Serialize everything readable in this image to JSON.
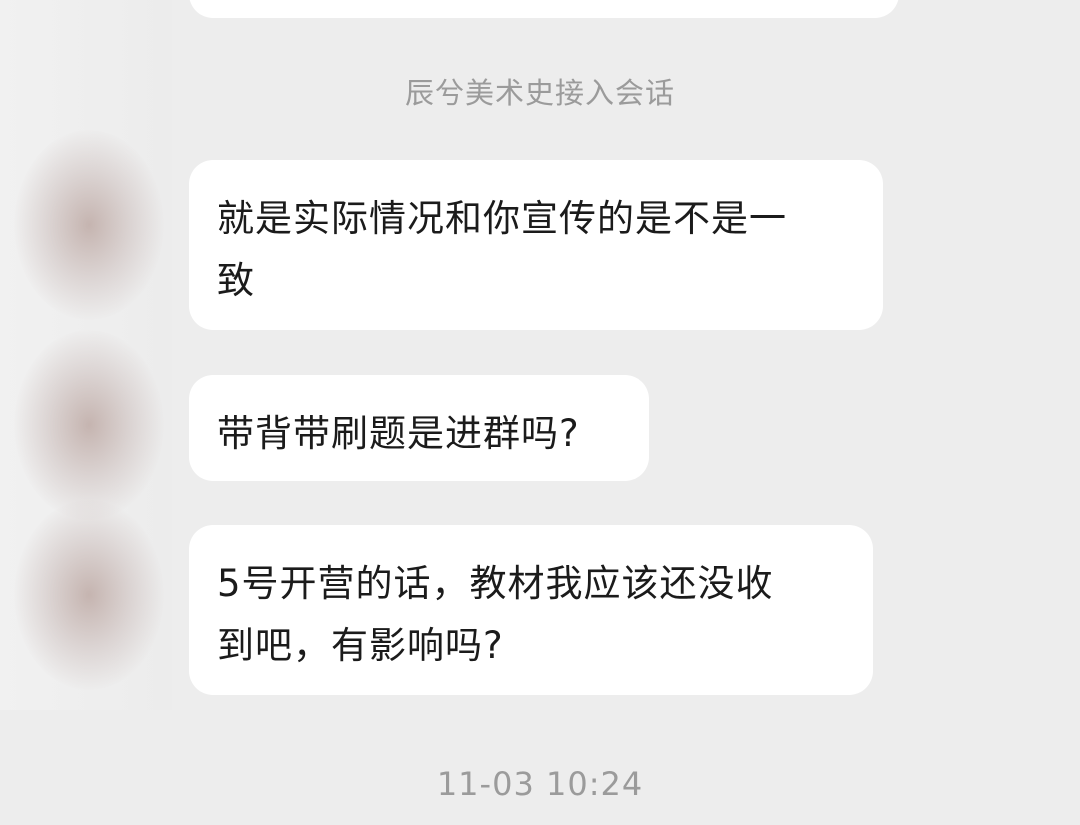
{
  "chat": {
    "system_notice": "辰兮美术史接入会话",
    "timestamp": "11-03 10:24",
    "messages": [
      {
        "text": "就是实际情况和你宣传的是不是一\n致"
      },
      {
        "text": "带背带刷题是进群吗?"
      },
      {
        "text": "5号开营的话，教材我应该还没收\n到吧，有影响吗?"
      }
    ]
  }
}
